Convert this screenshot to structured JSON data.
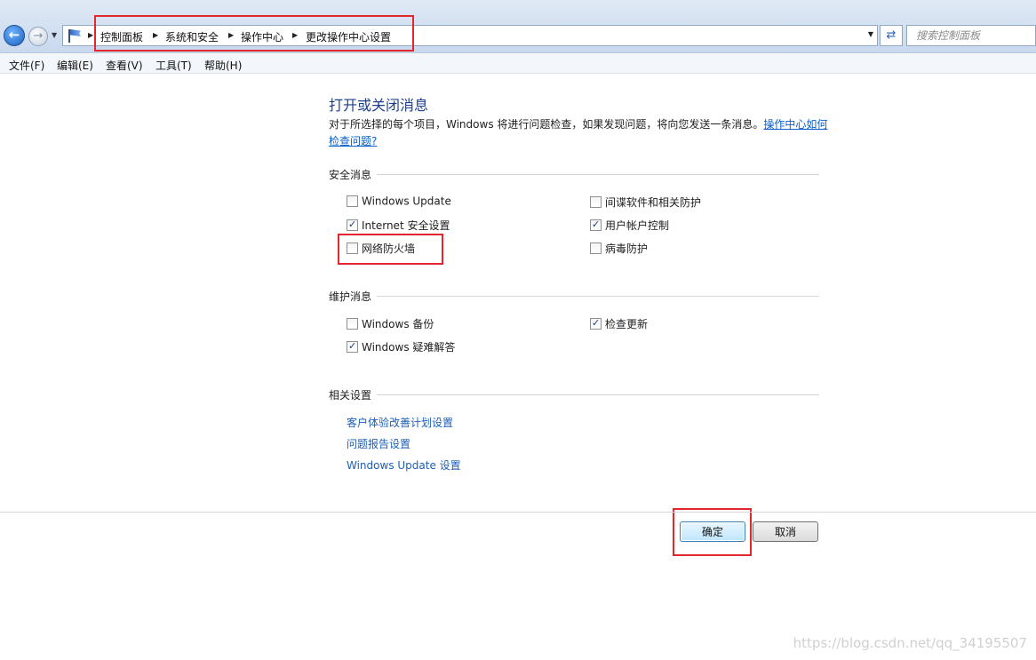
{
  "address_bar": {
    "breadcrumbs": [
      "控制面板",
      "系统和安全",
      "操作中心",
      "更改操作中心设置"
    ],
    "search_placeholder": "搜索控制面板"
  },
  "menu": [
    "文件(F)",
    "编辑(E)",
    "查看(V)",
    "工具(T)",
    "帮助(H)"
  ],
  "content": {
    "title": "打开或关闭消息",
    "description": "对于所选择的每个项目，Windows 将进行问题检查，如果发现问题，将向您发送一条消息。",
    "description_link": "操作中心如何检查问题?",
    "security_section": {
      "label": "安全消息",
      "items": [
        {
          "label": "Windows Update",
          "checked": false
        },
        {
          "label": "间谍软件和相关防护",
          "checked": false
        },
        {
          "label": "Internet 安全设置",
          "checked": true
        },
        {
          "label": "用户帐户控制",
          "checked": true
        },
        {
          "label": "网络防火墙",
          "checked": false
        },
        {
          "label": "病毒防护",
          "checked": false
        }
      ]
    },
    "maintenance_section": {
      "label": "维护消息",
      "items": [
        {
          "label": "Windows 备份",
          "checked": false
        },
        {
          "label": "检查更新",
          "checked": true
        },
        {
          "label": "Windows 疑难解答",
          "checked": true
        }
      ]
    },
    "related_section": {
      "label": "相关设置",
      "links": [
        "客户体验改善计划设置",
        "问题报告设置",
        "Windows Update 设置"
      ]
    }
  },
  "buttons": {
    "ok": "确定",
    "cancel": "取消"
  },
  "watermark": "https://blog.csdn.net/qq_34195507",
  "colors": {
    "highlight_box": "#e3262b",
    "link": "#1d5fb8",
    "title": "#1e3f8f"
  }
}
